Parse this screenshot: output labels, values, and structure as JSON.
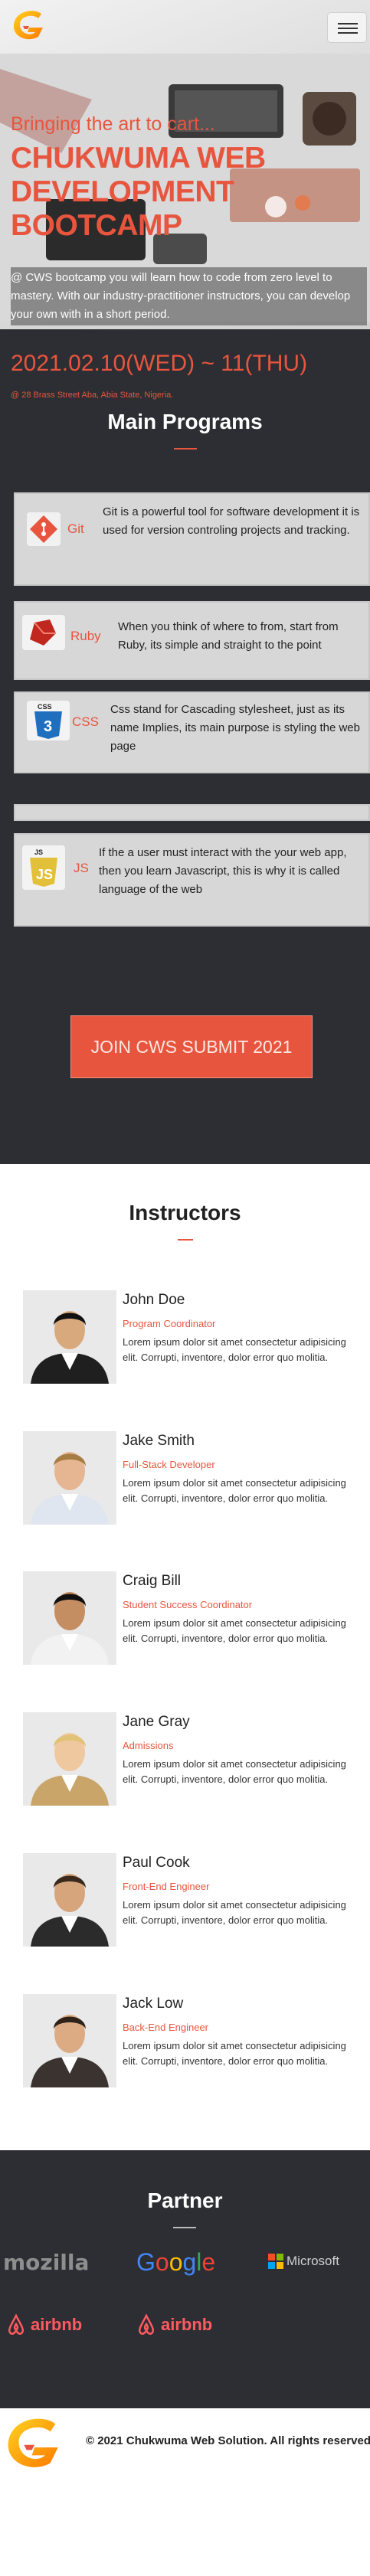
{
  "header": {
    "menu_label": "menu"
  },
  "hero": {
    "tagline": "Bringing the art to cart...",
    "title": "CHUKWUMA WEB DEVELOPMENT BOOTCAMP",
    "description": "@ CWS bootcamp you will learn how to code from zero level to mastery. With our industry-practitioner instructors, you can develop your own with in a short period.",
    "date": "2021.02.10(WED) ~ 11(THU)",
    "address": "@ 28 Brass Street Aba, Abia State, Nigeria."
  },
  "programs": {
    "title": "Main Programs",
    "items": [
      {
        "name": "Git",
        "text": "Git is a powerful tool for software development it is used for version controling projects and tracking."
      },
      {
        "name": "Ruby",
        "text": "When you think of where to from, start from Ruby, its simple and straight to the point"
      },
      {
        "name": "CSS",
        "text": "Css stand for Cascading stylesheet, just as its name Implies, its main purpose is styling the web page"
      },
      {
        "name": "JS",
        "text": "If the a user must interact with the your web app, then you learn Javascript, this is why it is called language of the web"
      }
    ],
    "cta_label": "JOIN CWS SUBMIT 2021"
  },
  "instructors": {
    "title": "Instructors",
    "items": [
      {
        "name": "John Doe",
        "role": "Program Coordinator",
        "bio": "Lorem ipsum dolor sit amet consectetur adipisicing elit. Corrupti, inventore, dolor error quo molitia."
      },
      {
        "name": "Jake Smith",
        "role": "Full-Stack Developer",
        "bio": "Lorem ipsum dolor sit amet consectetur adipisicing elit. Corrupti, inventore, dolor error quo molitia."
      },
      {
        "name": "Craig Bill",
        "role": "Student Success Coordinator",
        "bio": "Lorem ipsum dolor sit amet consectetur adipisicing elit. Corrupti, inventore, dolor error quo molitia."
      },
      {
        "name": "Jane Gray",
        "role": "Admissions",
        "bio": "Lorem ipsum dolor sit amet consectetur adipisicing elit. Corrupti, inventore, dolor error quo molitia."
      },
      {
        "name": "Paul Cook",
        "role": "Front-End Engineer",
        "bio": "Lorem ipsum dolor sit amet consectetur adipisicing elit. Corrupti, inventore, dolor error quo molitia."
      },
      {
        "name": "Jack Low",
        "role": "Back-End Engineer",
        "bio": "Lorem ipsum dolor sit amet consectetur adipisicing elit. Corrupti, inventore, dolor error quo molitia."
      }
    ]
  },
  "partners": {
    "title": "Partner",
    "logos": [
      "mozilla",
      "Google",
      "Microsoft",
      "airbnb",
      "airbnb"
    ]
  },
  "footer": {
    "copyright": "© 2021 Chukwuma Web Solution. All rights reserved"
  },
  "colors": {
    "accent": "#e8553e",
    "dark": "#2c2e33",
    "light_card": "#d7d7d7"
  }
}
